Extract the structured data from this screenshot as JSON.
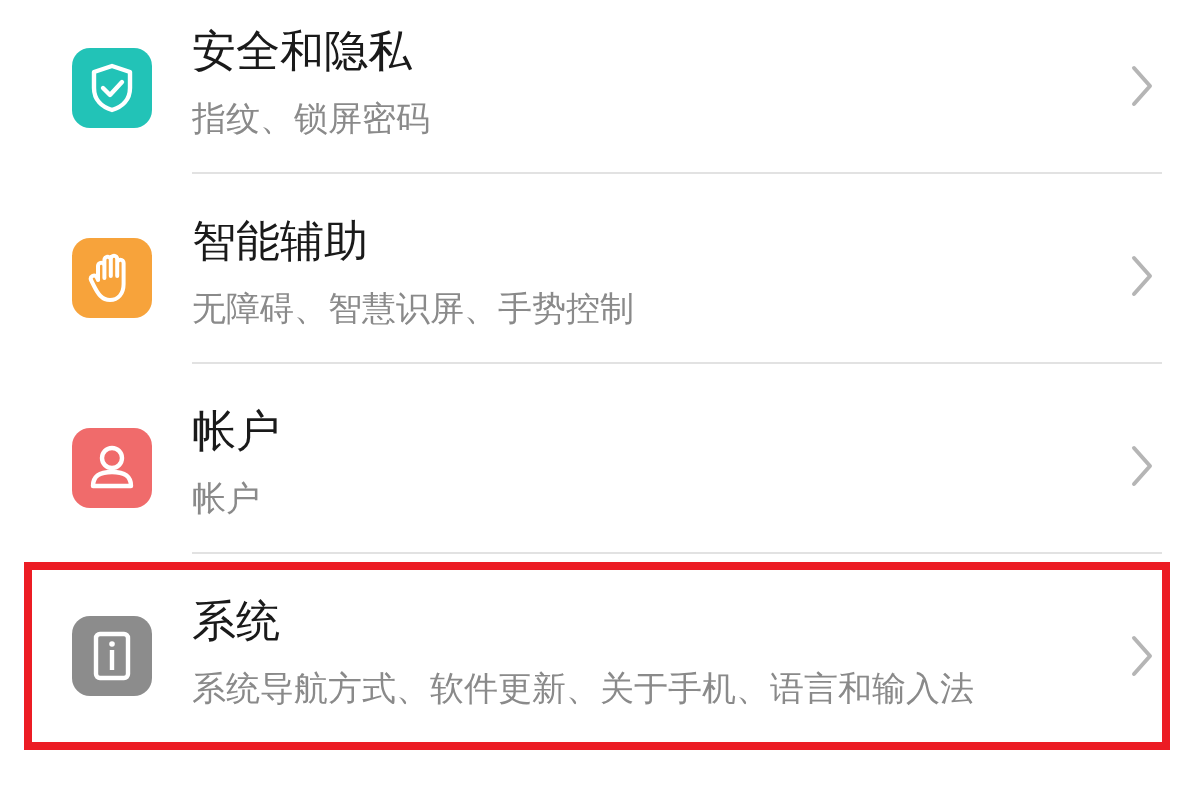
{
  "settings": [
    {
      "title": "安全和隐私",
      "subtitle": "指纹、锁屏密码",
      "color": "#22c3b7",
      "kind": "shield",
      "highlighted": false
    },
    {
      "title": "智能辅助",
      "subtitle": "无障碍、智慧识屏、手势控制",
      "color": "#f7a33b",
      "kind": "hand",
      "highlighted": false
    },
    {
      "title": "帐户",
      "subtitle": "帐户",
      "color": "#f06b6b",
      "kind": "person",
      "highlighted": false
    },
    {
      "title": "系统",
      "subtitle": "系统导航方式、软件更新、关于手机、语言和输入法",
      "color": "#8c8c8c",
      "kind": "info",
      "highlighted": true
    }
  ]
}
